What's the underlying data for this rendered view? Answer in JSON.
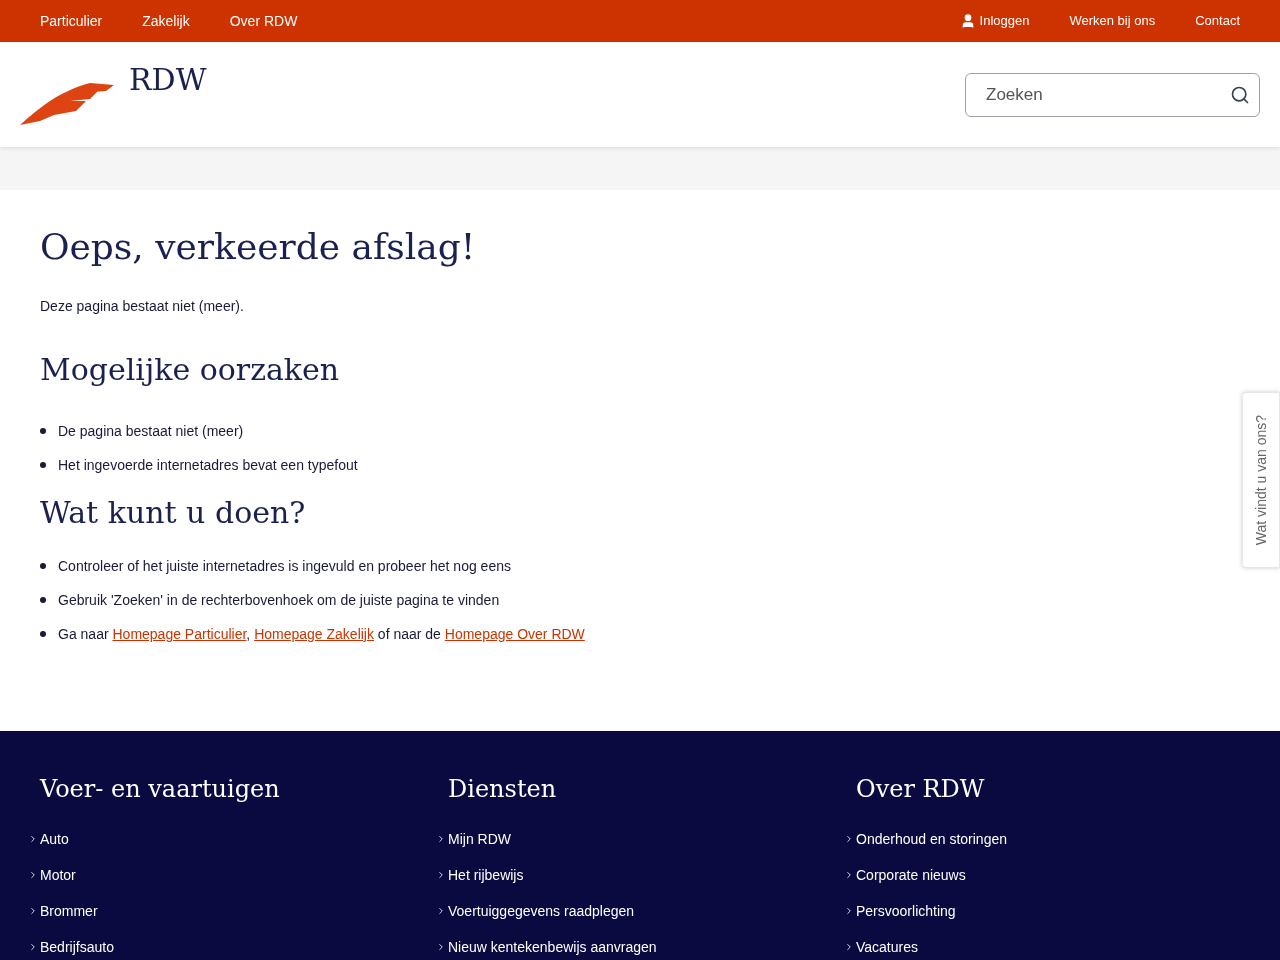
{
  "top_nav": {
    "left": [
      {
        "label": "Particulier"
      },
      {
        "label": "Zakelijk"
      },
      {
        "label": "Over RDW"
      }
    ],
    "login": "Inloggen",
    "right": [
      {
        "label": "Werken bij ons"
      },
      {
        "label": "Contact"
      }
    ]
  },
  "header": {
    "logo_text": "RDW",
    "search": {
      "placeholder": "Zoeken"
    }
  },
  "main": {
    "title": "Oeps, verkeerde afslag!",
    "intro": "Deze pagina bestaat niet (meer).",
    "sections": [
      {
        "heading": "Mogelijke oorzaken",
        "items": [
          {
            "parts": [
              {
                "kind": "text",
                "text": "De pagina bestaat niet (meer)"
              }
            ]
          },
          {
            "parts": [
              {
                "kind": "text",
                "text": "Het ingevoerde internetadres bevat een typefout"
              }
            ]
          }
        ]
      },
      {
        "heading": "Wat kunt u doen?",
        "items": [
          {
            "parts": [
              {
                "kind": "text",
                "text": "Controleer of het juiste internetadres is ingevuld en probeer het nog eens"
              }
            ]
          },
          {
            "parts": [
              {
                "kind": "text",
                "text": "Gebruik 'Zoeken' in de rechterbovenhoek om de juiste pagina te vinden"
              }
            ]
          },
          {
            "parts": [
              {
                "kind": "text",
                "text": "Ga naar "
              },
              {
                "kind": "link",
                "text": "Homepage Particulier"
              },
              {
                "kind": "text",
                "text": ", "
              },
              {
                "kind": "link",
                "text": "Homepage Zakelijk"
              },
              {
                "kind": "text",
                "text": " of naar de "
              },
              {
                "kind": "link",
                "text": "Homepage Over RDW"
              }
            ]
          }
        ]
      }
    ]
  },
  "feedback_tab": "Wat vindt u van ons?",
  "footer": {
    "columns": [
      {
        "heading": "Voer- en vaartuigen",
        "links": [
          "Auto",
          "Motor",
          "Brommer",
          "Bedrijfsauto"
        ]
      },
      {
        "heading": "Diensten",
        "links": [
          "Mijn RDW",
          "Het rijbewijs",
          "Voertuiggegevens raadplegen",
          "Nieuw kentekenbewijs aanvragen"
        ]
      },
      {
        "heading": "Over RDW",
        "links": [
          "Onderhoud en storingen",
          "Corporate nieuws",
          "Persvoorlichting",
          "Vacatures"
        ]
      }
    ]
  }
}
